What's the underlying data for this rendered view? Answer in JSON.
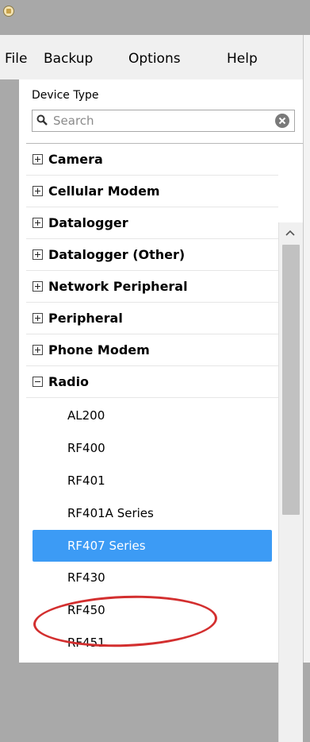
{
  "menu": {
    "file": "File",
    "backup": "Backup",
    "options": "Options",
    "help": "Help"
  },
  "panel": {
    "title": "Device Type",
    "search_placeholder": "Search"
  },
  "groups": [
    {
      "label": "Camera",
      "expanded": false
    },
    {
      "label": "Cellular Modem",
      "expanded": false
    },
    {
      "label": "Datalogger",
      "expanded": false
    },
    {
      "label": "Datalogger (Other)",
      "expanded": false
    },
    {
      "label": "Network Peripheral",
      "expanded": false
    },
    {
      "label": "Peripheral",
      "expanded": false
    },
    {
      "label": "Phone Modem",
      "expanded": false
    },
    {
      "label": "Radio",
      "expanded": true
    }
  ],
  "radio_items": [
    "AL200",
    "RF400",
    "RF401",
    "RF401A Series",
    "RF407 Series",
    "RF430",
    "RF450",
    "RF451"
  ],
  "selected_item": "RF407 Series",
  "colors": {
    "selection": "#3c9bf5",
    "annotation": "#d32f2f"
  }
}
